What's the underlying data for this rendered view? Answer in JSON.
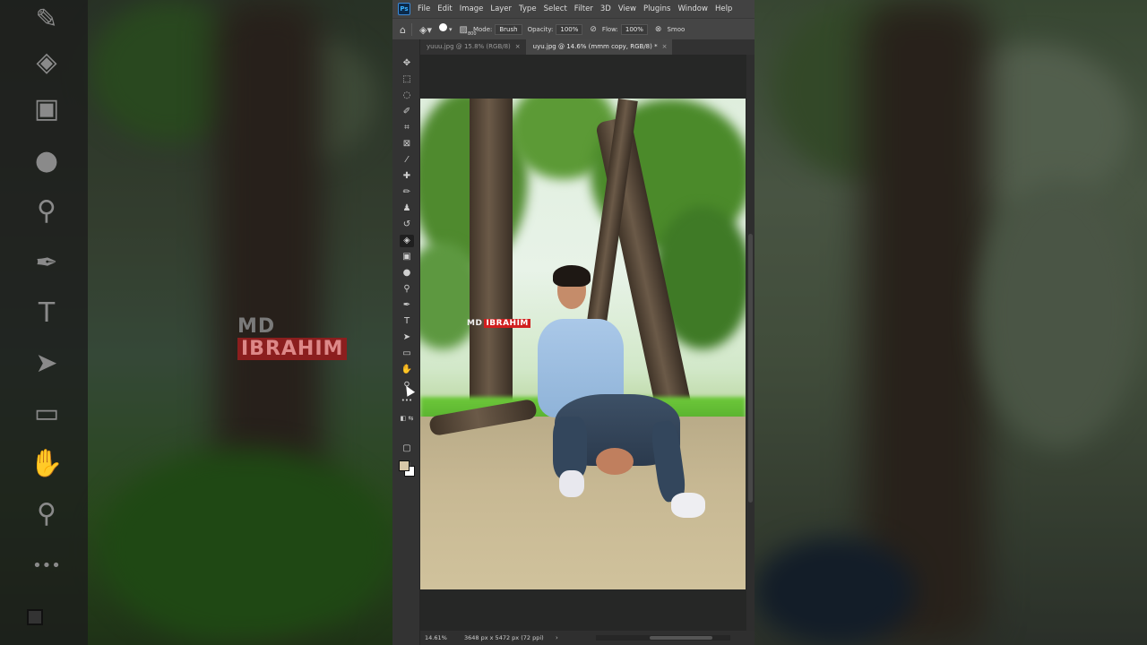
{
  "app": {
    "logo_text": "Ps",
    "menu": [
      "File",
      "Edit",
      "Image",
      "Layer",
      "Type",
      "Select",
      "Filter",
      "3D",
      "View",
      "Plugins",
      "Window",
      "Help"
    ]
  },
  "options": {
    "brush_size": "800",
    "mode_label": "Mode:",
    "mode_value": "Brush",
    "opacity_label": "Opacity:",
    "opacity_value": "100%",
    "flow_label": "Flow:",
    "flow_value": "100%",
    "smooth_label": "Smoo"
  },
  "tabs": [
    {
      "label": "yuuu.jpg @ 15.8% (RGB/8)",
      "active": false
    },
    {
      "label": "uyu.jpg @ 14.6% (mmm copy, RGB/8) *",
      "active": true
    }
  ],
  "status": {
    "zoom": "14.61%",
    "info": "3648 px x 5472 px (72 ppi)",
    "arrow": "›"
  },
  "watermark": {
    "part1": "MD",
    "part2": "IBRAHIM"
  },
  "colors": {
    "foreground": "#d8c8a8",
    "background": "#ffffff",
    "watermark_red": "#d11f1f"
  },
  "tools": [
    "move-icon",
    "marquee-icon",
    "lasso-icon",
    "quick-select-icon",
    "crop-icon",
    "frame-icon",
    "eyedropper-icon",
    "healing-icon",
    "brush-icon",
    "stamp-icon",
    "history-brush-icon",
    "eraser-icon",
    "gradient-icon",
    "blur-icon",
    "dodge-icon",
    "pen-icon",
    "type-icon",
    "path-select-icon",
    "rectangle-icon",
    "hand-icon",
    "zoom-icon",
    "more-icon"
  ]
}
